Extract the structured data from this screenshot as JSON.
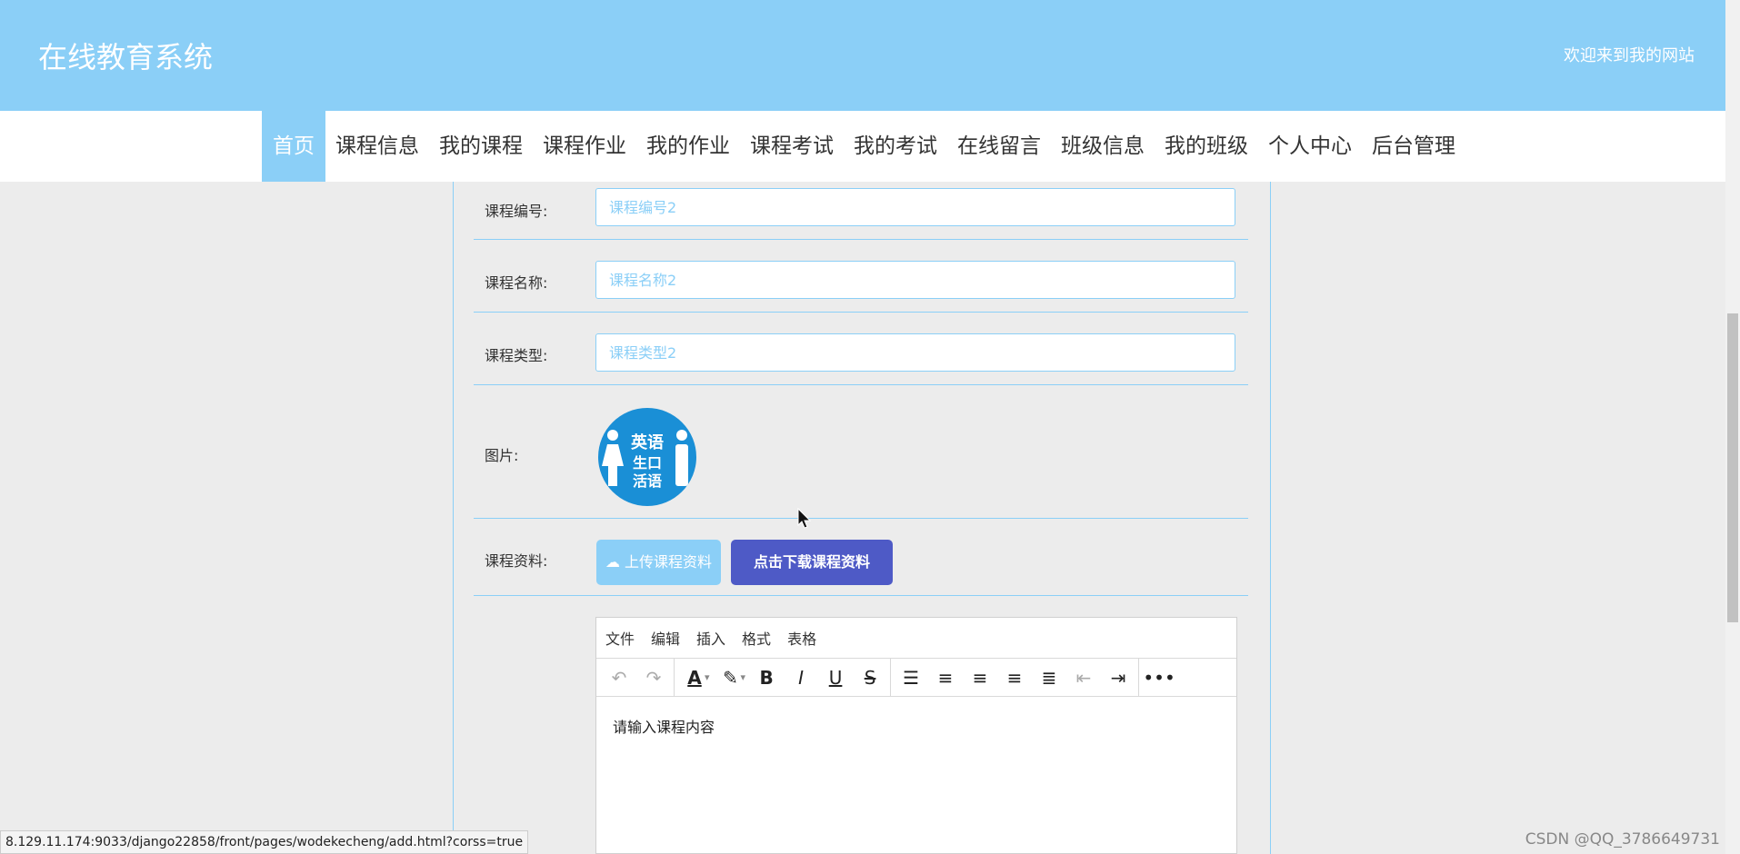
{
  "header": {
    "site_title": "在线教育系统",
    "welcome": "欢迎来到我的网站"
  },
  "nav": {
    "items": [
      {
        "label": "首页",
        "active": true
      },
      {
        "label": "课程信息"
      },
      {
        "label": "我的课程"
      },
      {
        "label": "课程作业"
      },
      {
        "label": "我的作业"
      },
      {
        "label": "课程考试"
      },
      {
        "label": "我的考试"
      },
      {
        "label": "在线留言"
      },
      {
        "label": "班级信息"
      },
      {
        "label": "我的班级"
      },
      {
        "label": "个人中心"
      },
      {
        "label": "后台管理"
      }
    ]
  },
  "form": {
    "course_no": {
      "label": "课程编号:",
      "placeholder": "课程编号2"
    },
    "course_name": {
      "label": "课程名称:",
      "placeholder": "课程名称2"
    },
    "course_type": {
      "label": "课程类型:",
      "placeholder": "课程类型2"
    },
    "image": {
      "label": "图片:",
      "logo_text": "英语 生口 活语"
    },
    "material": {
      "label": "课程资料:",
      "upload_label": "上传课程资料",
      "download_label": "点击下载课程资料"
    }
  },
  "editor": {
    "menus": [
      "文件",
      "编辑",
      "插入",
      "格式",
      "表格"
    ],
    "placeholder": "请输入课程内容",
    "toolbar_icons": [
      "undo-icon",
      "redo-icon",
      "text-color-icon",
      "highlight-icon",
      "bold-icon",
      "italic-icon",
      "underline-icon",
      "strikethrough-icon",
      "list-icon",
      "align-left-icon",
      "align-center-icon",
      "align-right-icon",
      "align-justify-icon",
      "outdent-icon",
      "indent-icon",
      "more-icon"
    ]
  },
  "status_bar": {
    "url": "8.129.11.174:9033/django22858/front/pages/wodekecheng/add.html?corss=true"
  },
  "watermark": "CSDN @QQ_3786649731",
  "colors": {
    "header_bg": "#8bcff7",
    "download_button": "#4e5ac6"
  }
}
